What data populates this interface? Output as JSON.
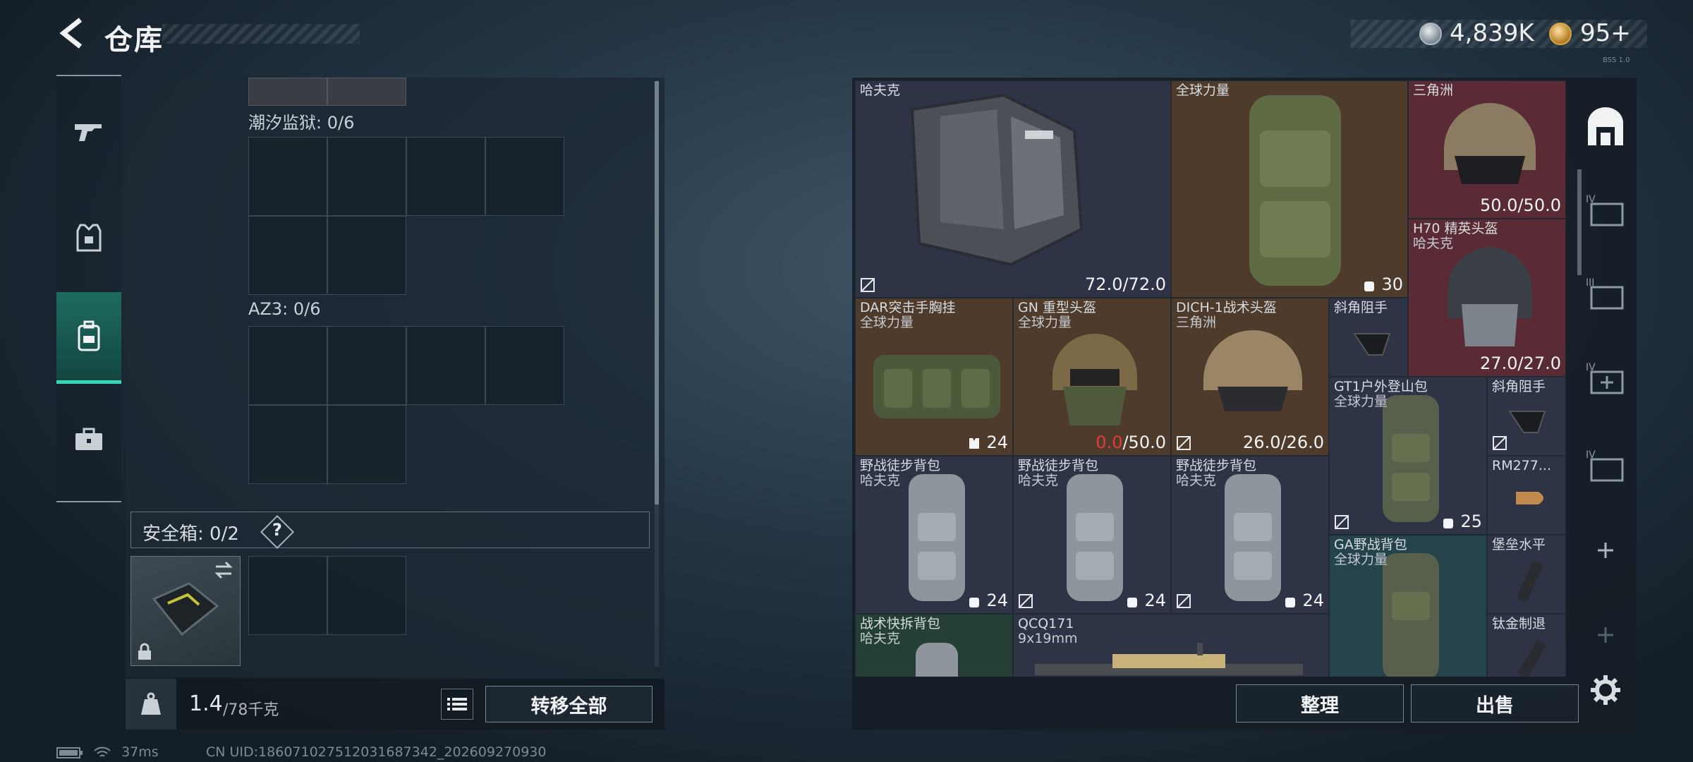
{
  "header": {
    "title": "仓库"
  },
  "currency": {
    "silver": "4,839K",
    "gold": "95+",
    "build": "BSS 1.0"
  },
  "left_panel": {
    "containers": [
      {
        "label": "潮汐监狱: 0/6"
      },
      {
        "label": "AZ3: 0/6"
      }
    ],
    "safebox_label": "安全箱: 0/2",
    "help": "?",
    "weight_current": "1.4",
    "weight_max": "/78千克",
    "transfer_all": "转移全部"
  },
  "inventory": {
    "items": [
      {
        "name": "哈夫克",
        "sub": "",
        "value": "72.0/72.0"
      },
      {
        "name": "全球力量",
        "sub": "",
        "value": "30"
      },
      {
        "name": "三角洲",
        "sub": "",
        "value": "50.0/50.0"
      },
      {
        "name": "H70 精英头盔",
        "sub": "哈夫克",
        "value": "27.0/27.0"
      },
      {
        "name": "DAR突击手胸挂",
        "sub": "全球力量",
        "value": "24"
      },
      {
        "name": "GN 重型头盔",
        "sub": "全球力量",
        "value_red": "0.0",
        "value": "/50.0"
      },
      {
        "name": "DICH-1战术头盔",
        "sub": "三角洲",
        "value": "26.0/26.0"
      },
      {
        "name": "斜角阻手",
        "sub": "",
        "value": ""
      },
      {
        "name": "GT1户外登山包",
        "sub": "全球力量",
        "value": "25"
      },
      {
        "name": "斜角阻手",
        "sub": "",
        "value": ""
      },
      {
        "name": "野战徒步背包",
        "sub": "哈夫克",
        "value": "24"
      },
      {
        "name": "野战徒步背包",
        "sub": "哈夫克",
        "value": "24"
      },
      {
        "name": "野战徒步背包",
        "sub": "哈夫克",
        "value": "24"
      },
      {
        "name": "RM277...",
        "sub": "",
        "value": ""
      },
      {
        "name": "GA野战背包",
        "sub": "全球力量",
        "value": ""
      },
      {
        "name": "堡垒水平",
        "sub": "",
        "value": ""
      },
      {
        "name": "战术快拆背包",
        "sub": "哈夫克",
        "value": ""
      },
      {
        "name": "QCQ171",
        "sub": "9x19mm",
        "value": ""
      },
      {
        "name": "钛金制退",
        "sub": "",
        "value": ""
      }
    ],
    "sort": "整理",
    "sell": "出售"
  },
  "status": {
    "ping": "37ms",
    "uid": "CN UID:18607102751203168734​2_202609270930"
  }
}
